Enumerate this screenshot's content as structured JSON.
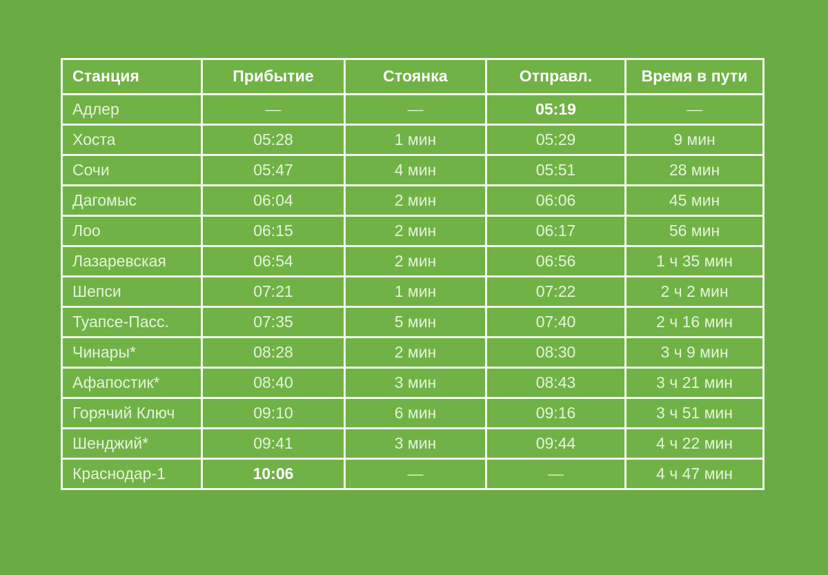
{
  "theme": {
    "page_background": "#6aab43",
    "cell_background": "#70b246",
    "grid_line": "#f2faec",
    "header_text": "#ffffff",
    "body_text": "#e6f4da",
    "emphasis_text": "#ffffff"
  },
  "table": {
    "name": "train-schedule",
    "dash_symbol": "—",
    "columns": [
      {
        "key": "station",
        "label": "Станция",
        "align": "left"
      },
      {
        "key": "arrival",
        "label": "Прибытие",
        "align": "center"
      },
      {
        "key": "stop",
        "label": "Стоянка",
        "align": "center"
      },
      {
        "key": "departure",
        "label": "Отправл.",
        "align": "center"
      },
      {
        "key": "travel_time",
        "label": "Время в пути",
        "align": "center"
      }
    ],
    "rows": [
      {
        "station": "Адлер",
        "arrival": "—",
        "stop": "—",
        "departure": "05:19",
        "travel_time": "—",
        "emphasis": "departure"
      },
      {
        "station": "Хоста",
        "arrival": "05:28",
        "stop": "1 мин",
        "departure": "05:29",
        "travel_time": "9 мин",
        "emphasis": ""
      },
      {
        "station": "Сочи",
        "arrival": "05:47",
        "stop": "4 мин",
        "departure": "05:51",
        "travel_time": "28 мин",
        "emphasis": ""
      },
      {
        "station": "Дагомыс",
        "arrival": "06:04",
        "stop": "2 мин",
        "departure": "06:06",
        "travel_time": "45 мин",
        "emphasis": ""
      },
      {
        "station": "Лоо",
        "arrival": "06:15",
        "stop": "2 мин",
        "departure": "06:17",
        "travel_time": "56 мин",
        "emphasis": ""
      },
      {
        "station": "Лазаревская",
        "arrival": "06:54",
        "stop": "2 мин",
        "departure": "06:56",
        "travel_time": "1 ч 35 мин",
        "emphasis": ""
      },
      {
        "station": "Шепси",
        "arrival": "07:21",
        "stop": "1 мин",
        "departure": "07:22",
        "travel_time": "2 ч 2 мин",
        "emphasis": ""
      },
      {
        "station": "Туапсе-Пасс.",
        "arrival": "07:35",
        "stop": "5 мин",
        "departure": "07:40",
        "travel_time": "2 ч 16 мин",
        "emphasis": ""
      },
      {
        "station": "Чинары*",
        "arrival": "08:28",
        "stop": "2 мин",
        "departure": "08:30",
        "travel_time": "3 ч 9 мин",
        "emphasis": ""
      },
      {
        "station": "Афапостик*",
        "arrival": "08:40",
        "stop": "3 мин",
        "departure": "08:43",
        "travel_time": "3 ч 21 мин",
        "emphasis": ""
      },
      {
        "station": "Горячий Ключ",
        "arrival": "09:10",
        "stop": "6 мин",
        "departure": "09:16",
        "travel_time": "3 ч 51 мин",
        "emphasis": ""
      },
      {
        "station": "Шенджий*",
        "arrival": "09:41",
        "stop": "3 мин",
        "departure": "09:44",
        "travel_time": "4 ч 22 мин",
        "emphasis": ""
      },
      {
        "station": "Краснодар-1",
        "arrival": "10:06",
        "stop": "—",
        "departure": "—",
        "travel_time": "4 ч 47 мин",
        "emphasis": "arrival"
      }
    ]
  }
}
